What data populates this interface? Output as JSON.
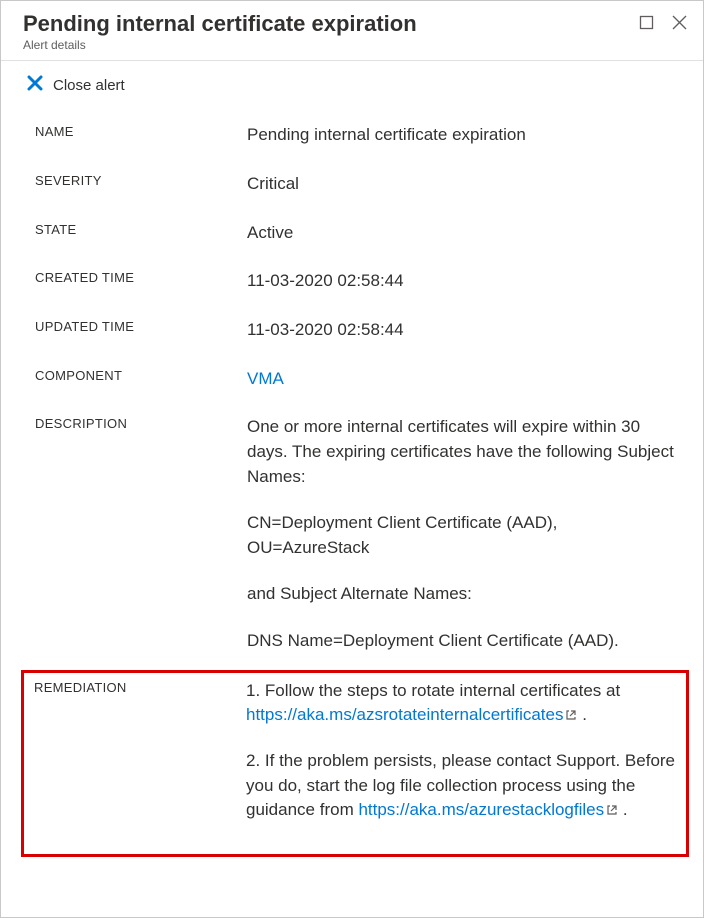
{
  "header": {
    "title": "Pending internal certificate expiration",
    "subtitle": "Alert details"
  },
  "toolbar": {
    "close_alert_label": "Close alert"
  },
  "labels": {
    "name": "NAME",
    "severity": "SEVERITY",
    "state": "STATE",
    "created_time": "CREATED TIME",
    "updated_time": "UPDATED TIME",
    "component": "COMPONENT",
    "description": "DESCRIPTION",
    "remediation": "REMEDIATION"
  },
  "values": {
    "name": "Pending internal certificate expiration",
    "severity": "Critical",
    "state": "Active",
    "created_time": "11-03-2020 02:58:44",
    "updated_time": "11-03-2020 02:58:44",
    "component": "VMA"
  },
  "description": {
    "p1": "One or more internal certificates will expire within 30 days. The expiring certificates have the following Subject Names:",
    "p2": "CN=Deployment Client Certificate (AAD), OU=AzureStack",
    "p3": "and Subject Alternate Names:",
    "p4": "DNS Name=Deployment Client Certificate (AAD)."
  },
  "remediation": {
    "step1_prefix": "1. Follow the steps to rotate internal certificates at ",
    "step1_link": "https://aka.ms/azsrotateinternalcertificates",
    "step1_suffix": " .",
    "step2_prefix": "2. If the problem persists, please contact Support. Before you do, start the log file collection process using the guidance from ",
    "step2_link": "https://aka.ms/azurestacklogfiles",
    "step2_suffix": " ."
  }
}
